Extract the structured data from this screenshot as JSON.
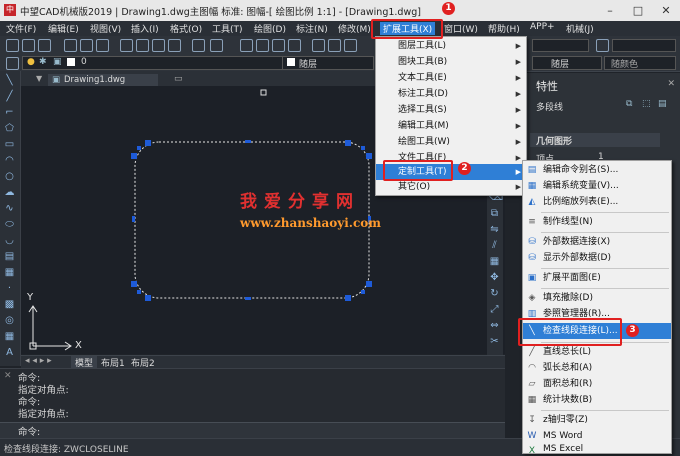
{
  "titlebar": {
    "logo": "中",
    "title": "中望CAD机械版2019 | Drawing1.dwg主图幅  标准: 图幅-[ 绘图比例 1:1] - [Drawing1.dwg]"
  },
  "menubar": [
    "文件(F)",
    "编辑(E)",
    "视图(V)",
    "插入(I)",
    "格式(O)",
    "工具(T)",
    "绘图(D)",
    "标注(N)",
    "修改(M)",
    "扩展工具(X)",
    "窗口(W)",
    "帮助(H)",
    "APP+",
    "机械(J)"
  ],
  "toolbar2": {
    "layer_value": "0",
    "linetype_1": "随层",
    "linetype_2": "随层",
    "lineweight": "随颜色"
  },
  "document": {
    "tab": "Drawing1.dwg",
    "axis_x": "X",
    "axis_y": "Y"
  },
  "layout_tabs": [
    "模型",
    "布局1",
    "布局2"
  ],
  "command_lines": [
    "命令:",
    "指定对角点:",
    "命令:",
    "指定对角点:"
  ],
  "command_prompt": "命令:",
  "status_text": "检查线段连接: ZWCLOSELINE",
  "properties": {
    "title": "特性",
    "object_type": "多段线",
    "section": "几何图形",
    "vertex_label": "顶点",
    "vertex_value": "1"
  },
  "extend_menu": {
    "items": [
      "图层工具(L)",
      "图块工具(B)",
      "文本工具(E)",
      "标注工具(D)",
      "选择工具(S)",
      "编辑工具(M)",
      "绘图工具(W)",
      "文件工具(F)",
      "定制工具(T)",
      "其它(O)"
    ],
    "highlighted": "定制工具(T)"
  },
  "custom_submenu": {
    "items": [
      "编辑命令别名(S)...",
      "编辑系统变量(V)...",
      "比例缩放列表(E)...",
      "制作线型(N)",
      "外部数据连接(X)",
      "显示外部数据(D)",
      "扩展平面图(E)",
      "填充撒除(D)",
      "参照管理器(R)...",
      "检查线段连接(L)...",
      "直线总长(L)",
      "弧长总和(A)",
      "面积总和(R)",
      "统计块数(B)",
      "z轴归零(Z)",
      "MS Word",
      "MS Excel"
    ],
    "highlighted": "检查线段连接(L)..."
  },
  "watermark": {
    "line1": "我爱分享网",
    "line2": "www.zhanshaoyi.com"
  },
  "badges": [
    "1",
    "2",
    "3"
  ],
  "colors": {
    "highlight": "#2f7fd6",
    "callout": "#e02020",
    "grip": "#1e5bd8"
  }
}
